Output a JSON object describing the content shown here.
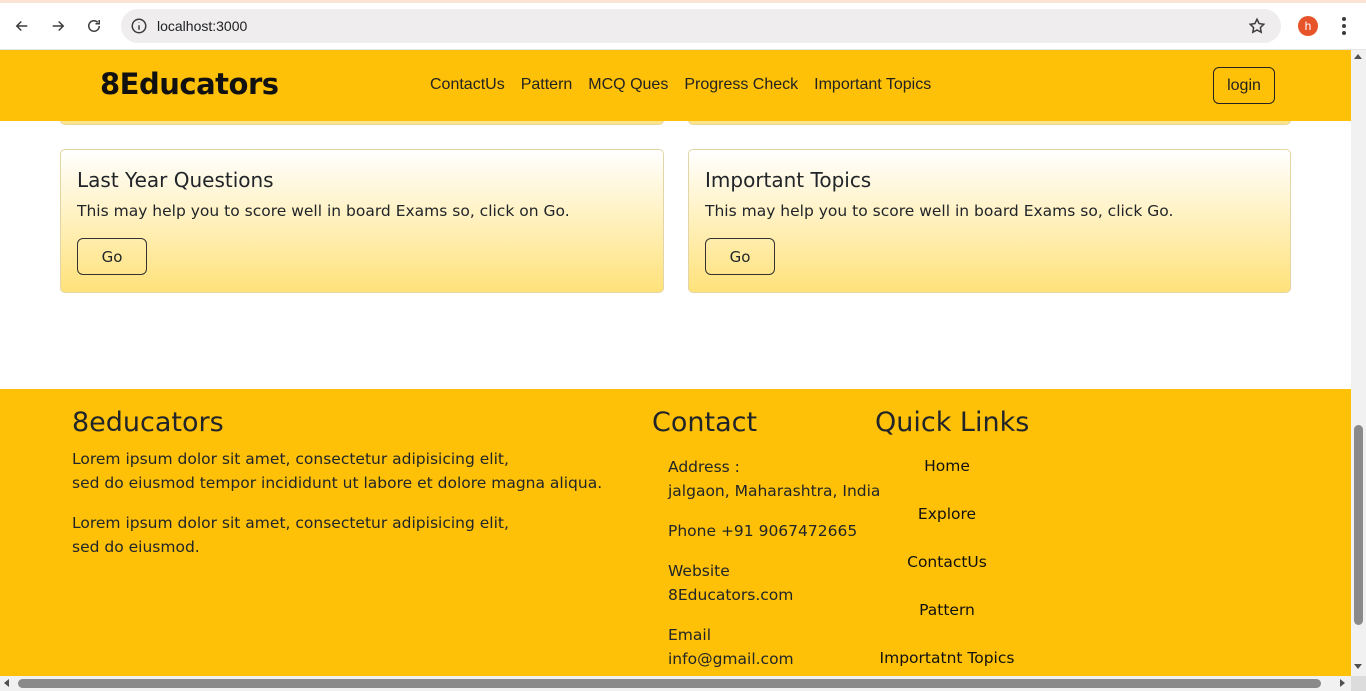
{
  "browser": {
    "url": "localhost:3000",
    "avatar_letter": "h",
    "icons": [
      "back-arrow-icon",
      "forward-arrow-icon",
      "reload-icon",
      "info-icon",
      "star-icon",
      "more-vert-icon"
    ]
  },
  "header": {
    "brand": "8Educators",
    "nav": [
      "ContactUs",
      "Pattern",
      "MCQ Ques",
      "Progress Check",
      "Important Topics"
    ],
    "login_label": "login",
    "bg_color": "#ffc107"
  },
  "cards": [
    {
      "title": "Last Year Questions",
      "text": "This may help you to score well in board Exams so, click on Go.",
      "button": "Go"
    },
    {
      "title": "Important Topics",
      "text": "This may help you to score well in board Exams so, click Go.",
      "button": "Go"
    }
  ],
  "footer": {
    "brand_title": "8educators",
    "para1_line1": "Lorem ipsum dolor sit amet, consectetur adipisicing elit,",
    "para1_line2": "sed do eiusmod tempor incididunt ut labore et dolore magna aliqua.",
    "para2_line1": "Lorem ipsum dolor sit amet, consectetur adipisicing elit,",
    "para2_line2": "sed do eiusmod.",
    "contact_heading": "Contact",
    "address_label": "Address :",
    "address_value": "jalgaon, Maharashtra, India",
    "phone": "Phone +91 9067472665",
    "website_label": "Website",
    "website_value": "8Educators.com",
    "email_label": "Email",
    "email_value": "info@gmail.com",
    "quick_links_heading": "Quick Links",
    "quick_links": [
      "Home",
      "Explore",
      "ContactUs",
      "Pattern",
      "Importatnt Topics"
    ]
  }
}
